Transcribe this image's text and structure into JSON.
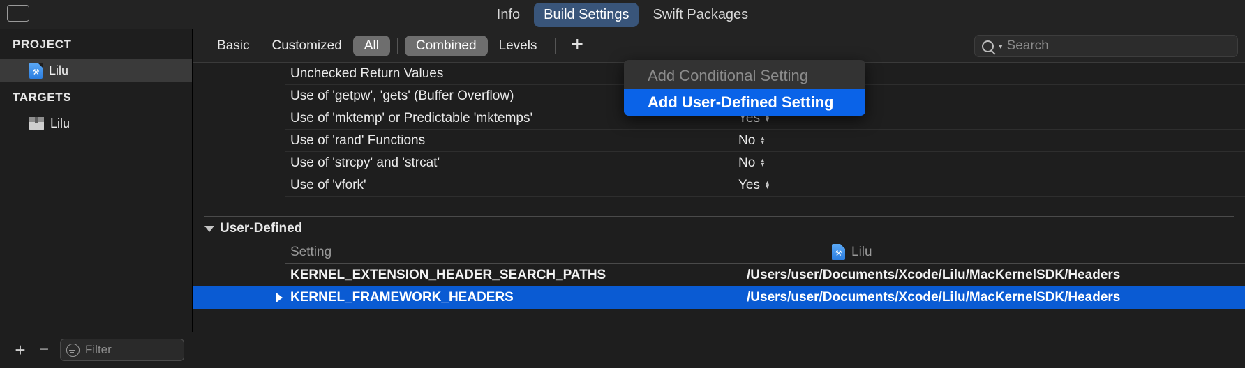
{
  "window": {
    "sidebar_toggle_icon": "sidebar-toggle-icon"
  },
  "tabs": [
    {
      "label": "Info",
      "active": false
    },
    {
      "label": "Build Settings",
      "active": true
    },
    {
      "label": "Swift Packages",
      "active": false
    }
  ],
  "navigator": {
    "project_header": "PROJECT",
    "project_items": [
      {
        "label": "Lilu",
        "icon": "xcode-project-icon",
        "selected": true
      }
    ],
    "targets_header": "TARGETS",
    "target_items": [
      {
        "label": "Lilu",
        "icon": "app-target-icon",
        "selected": false
      }
    ],
    "bottom": {
      "add_label": "+",
      "remove_label": "−",
      "filter_placeholder": "Filter",
      "filter_value": ""
    }
  },
  "filterbar": {
    "segments": [
      {
        "label": "Basic",
        "on": false
      },
      {
        "label": "Customized",
        "on": false
      },
      {
        "label": "All",
        "on": true
      },
      {
        "label": "Combined",
        "on": true
      },
      {
        "label": "Levels",
        "on": false
      }
    ],
    "add_button": "+",
    "search_placeholder": "Search",
    "search_value": ""
  },
  "menu": {
    "items": [
      {
        "label": "Add Conditional Setting",
        "state": "disabled"
      },
      {
        "label": "Add User-Defined Setting",
        "state": "highlighted"
      }
    ]
  },
  "settings_rows": [
    {
      "name": "Unchecked Return Values",
      "value": ""
    },
    {
      "name": "Use of 'getpw', 'gets' (Buffer Overflow)",
      "value": ""
    },
    {
      "name": "Use of 'mktemp' or Predictable 'mktemps'",
      "value": "Yes"
    },
    {
      "name": "Use of 'rand' Functions",
      "value": "No"
    },
    {
      "name": "Use of 'strcpy' and 'strcat'",
      "value": "No"
    },
    {
      "name": "Use of 'vfork'",
      "value": "Yes"
    }
  ],
  "user_defined": {
    "group_title": "User-Defined",
    "columns": {
      "setting": "Setting",
      "target": "Lilu"
    },
    "rows": [
      {
        "name": "KERNEL_EXTENSION_HEADER_SEARCH_PATHS",
        "value": "/Users/user/Documents/Xcode/Lilu/MacKernelSDK/Headers",
        "selected": false,
        "expandable": false
      },
      {
        "name": "KERNEL_FRAMEWORK_HEADERS",
        "value": "/Users/user/Documents/Xcode/Lilu/MacKernelSDK/Headers",
        "selected": true,
        "expandable": true
      }
    ]
  },
  "colors": {
    "accent_blue": "#0a5bd3",
    "menu_highlight": "#0a63e8",
    "tab_active_bg": "#39557a",
    "segment_on_bg": "#6e6e6e",
    "background": "#1e1e1e"
  }
}
